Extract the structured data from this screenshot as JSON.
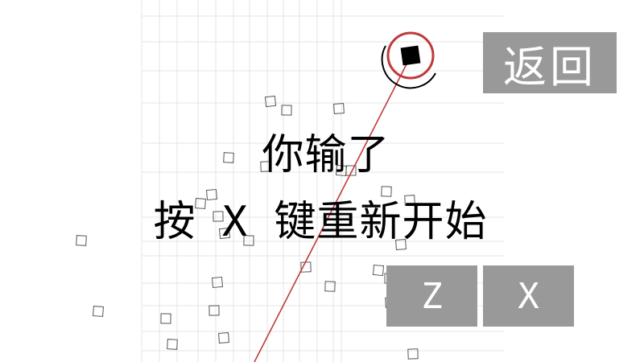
{
  "game": {
    "lose_text": "你输了",
    "restart_text": "按 X 键重新开始"
  },
  "buttons": {
    "back_label": "返回",
    "z_label": "Z",
    "x_label": "X"
  },
  "colors": {
    "background": "#ffffff",
    "grid": "#e4e4e4",
    "aim_line": "#c0393b",
    "ring": "#c0393b",
    "player": "#000000",
    "button_bg": "#999999",
    "button_text": "#ffffff",
    "particle_stroke": "#555555"
  },
  "icons": {
    "player": "black-square-player",
    "aim": "red-aim-line",
    "particles": "hollow-square-particles"
  }
}
